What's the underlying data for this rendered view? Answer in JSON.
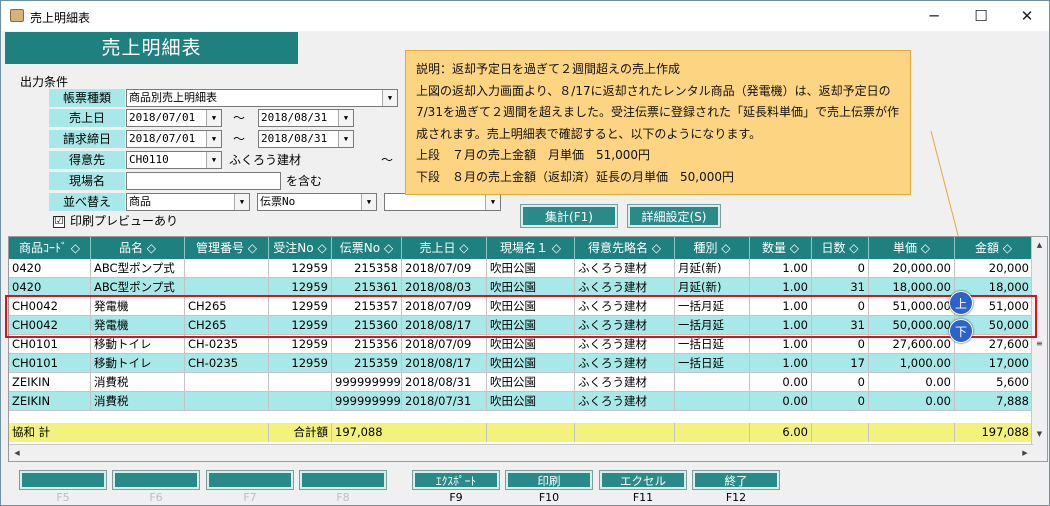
{
  "window": {
    "title": "売上明細表",
    "min": "─",
    "max": "☐",
    "close": "✕"
  },
  "header": {
    "title": "売上明細表"
  },
  "conditions": {
    "section_title": "出力条件",
    "report_type": {
      "label": "帳票種類",
      "value": "商品別売上明細表"
    },
    "sales_date": {
      "label": "売上日",
      "from": "2018/07/01",
      "to": "2018/08/31"
    },
    "closing_date": {
      "label": "請求締日",
      "from": "2018/07/01",
      "to": "2018/08/31"
    },
    "customer": {
      "label": "得意先",
      "code": "CH0110",
      "name": "ふくろう建材",
      "tilde": "〜"
    },
    "site": {
      "label": "現場名",
      "value": "",
      "suffix": "を含む"
    },
    "sort": {
      "label": "並べ替え",
      "key1": "商品",
      "key2": "伝票No",
      "key3": ""
    },
    "tilde": "〜",
    "preview": {
      "checked": "☑",
      "label": "印刷プレビューあり"
    }
  },
  "buttons": {
    "aggregate": "集計(F1)",
    "detail": "詳細設定(S)"
  },
  "callout": {
    "lines": [
      "説明：返却予定日を過ぎて２週間超えの売上作成",
      "上図の返却入力画面より、８/17に返却されたレンタル商品（発電機）は、返却予定日の",
      "7/31を過ぎて２週間を超えました。受注伝票に登録された「延長料単価」で売上伝票が作",
      "成されます。売上明細表で確認すると、以下のようになります。",
      "上段　７月の売上金額　月単価　51,000円",
      "下段　８月の売上金額（返却済）延長の月単価　50,000円"
    ]
  },
  "table": {
    "headers": [
      "商品ｺｰﾄﾞ",
      "品名",
      "管理番号",
      "受注No",
      "伝票No",
      "売上日",
      "現場名１",
      "得意先略名",
      "種別",
      "数量",
      "日数",
      "単価",
      "金額"
    ],
    "sort_mark": "◇",
    "rows": [
      [
        "0420",
        "ABC型ポンプ式",
        "",
        "12959",
        "215358",
        "2018/07/09",
        "吹田公園",
        "ふくろう建材",
        "月延(新)",
        "1.00",
        "0",
        "20,000.00",
        "20,000"
      ],
      [
        "0420",
        "ABC型ポンプ式",
        "",
        "12959",
        "215361",
        "2018/08/03",
        "吹田公園",
        "ふくろう建材",
        "月延(新)",
        "1.00",
        "31",
        "18,000.00",
        "18,000"
      ],
      [
        "CH0042",
        "発電機",
        "CH265",
        "12959",
        "215357",
        "2018/07/09",
        "吹田公園",
        "ふくろう建材",
        "一括月延",
        "1.00",
        "0",
        "51,000.00",
        "51,000"
      ],
      [
        "CH0042",
        "発電機",
        "CH265",
        "12959",
        "215360",
        "2018/08/17",
        "吹田公園",
        "ふくろう建材",
        "一括月延",
        "1.00",
        "31",
        "50,000.00",
        "50,000"
      ],
      [
        "CH0101",
        "移動トイレ",
        "CH-0235",
        "12959",
        "215356",
        "2018/07/09",
        "吹田公園",
        "ふくろう建材",
        "一括日延",
        "1.00",
        "0",
        "27,600.00",
        "27,600"
      ],
      [
        "CH0101",
        "移動トイレ",
        "CH-0235",
        "12959",
        "215359",
        "2018/08/17",
        "吹田公園",
        "ふくろう建材",
        "一括日延",
        "1.00",
        "17",
        "1,000.00",
        "17,000"
      ],
      [
        "ZEIKIN",
        "消費税",
        "",
        "",
        "999999999",
        "2018/08/31",
        "吹田公園",
        "ふくろう建材",
        "",
        "0.00",
        "0",
        "0.00",
        "5,600"
      ],
      [
        "ZEIKIN",
        "消費税",
        "",
        "",
        "999999999",
        "2018/07/31",
        "吹田公園",
        "ふくろう建材",
        "",
        "0.00",
        "0",
        "0.00",
        "7,888"
      ]
    ],
    "total": {
      "label": "協和 計",
      "sum_label": "合計額",
      "sum_value": "197,088",
      "qty": "6.00",
      "amount": "197,088"
    }
  },
  "markers": {
    "upper": "上",
    "lower": "下"
  },
  "fkeys": [
    {
      "label": "",
      "num": "F5"
    },
    {
      "label": "",
      "num": "F6"
    },
    {
      "label": "",
      "num": "F7"
    },
    {
      "label": "",
      "num": "F8"
    },
    {
      "label": "ｴｸｽﾎﾟｰﾄ",
      "num": "F9"
    },
    {
      "label": "印刷",
      "num": "F10"
    },
    {
      "label": "エクセル",
      "num": "F11"
    },
    {
      "label": "終了",
      "num": "F12"
    }
  ],
  "colors": {
    "teal": "#1f8080",
    "row_alt": "#a9e8e8",
    "total": "#f2f27c",
    "callout": "#fdd482",
    "highlight": "#d8141e",
    "marker": "#2d62c8"
  }
}
